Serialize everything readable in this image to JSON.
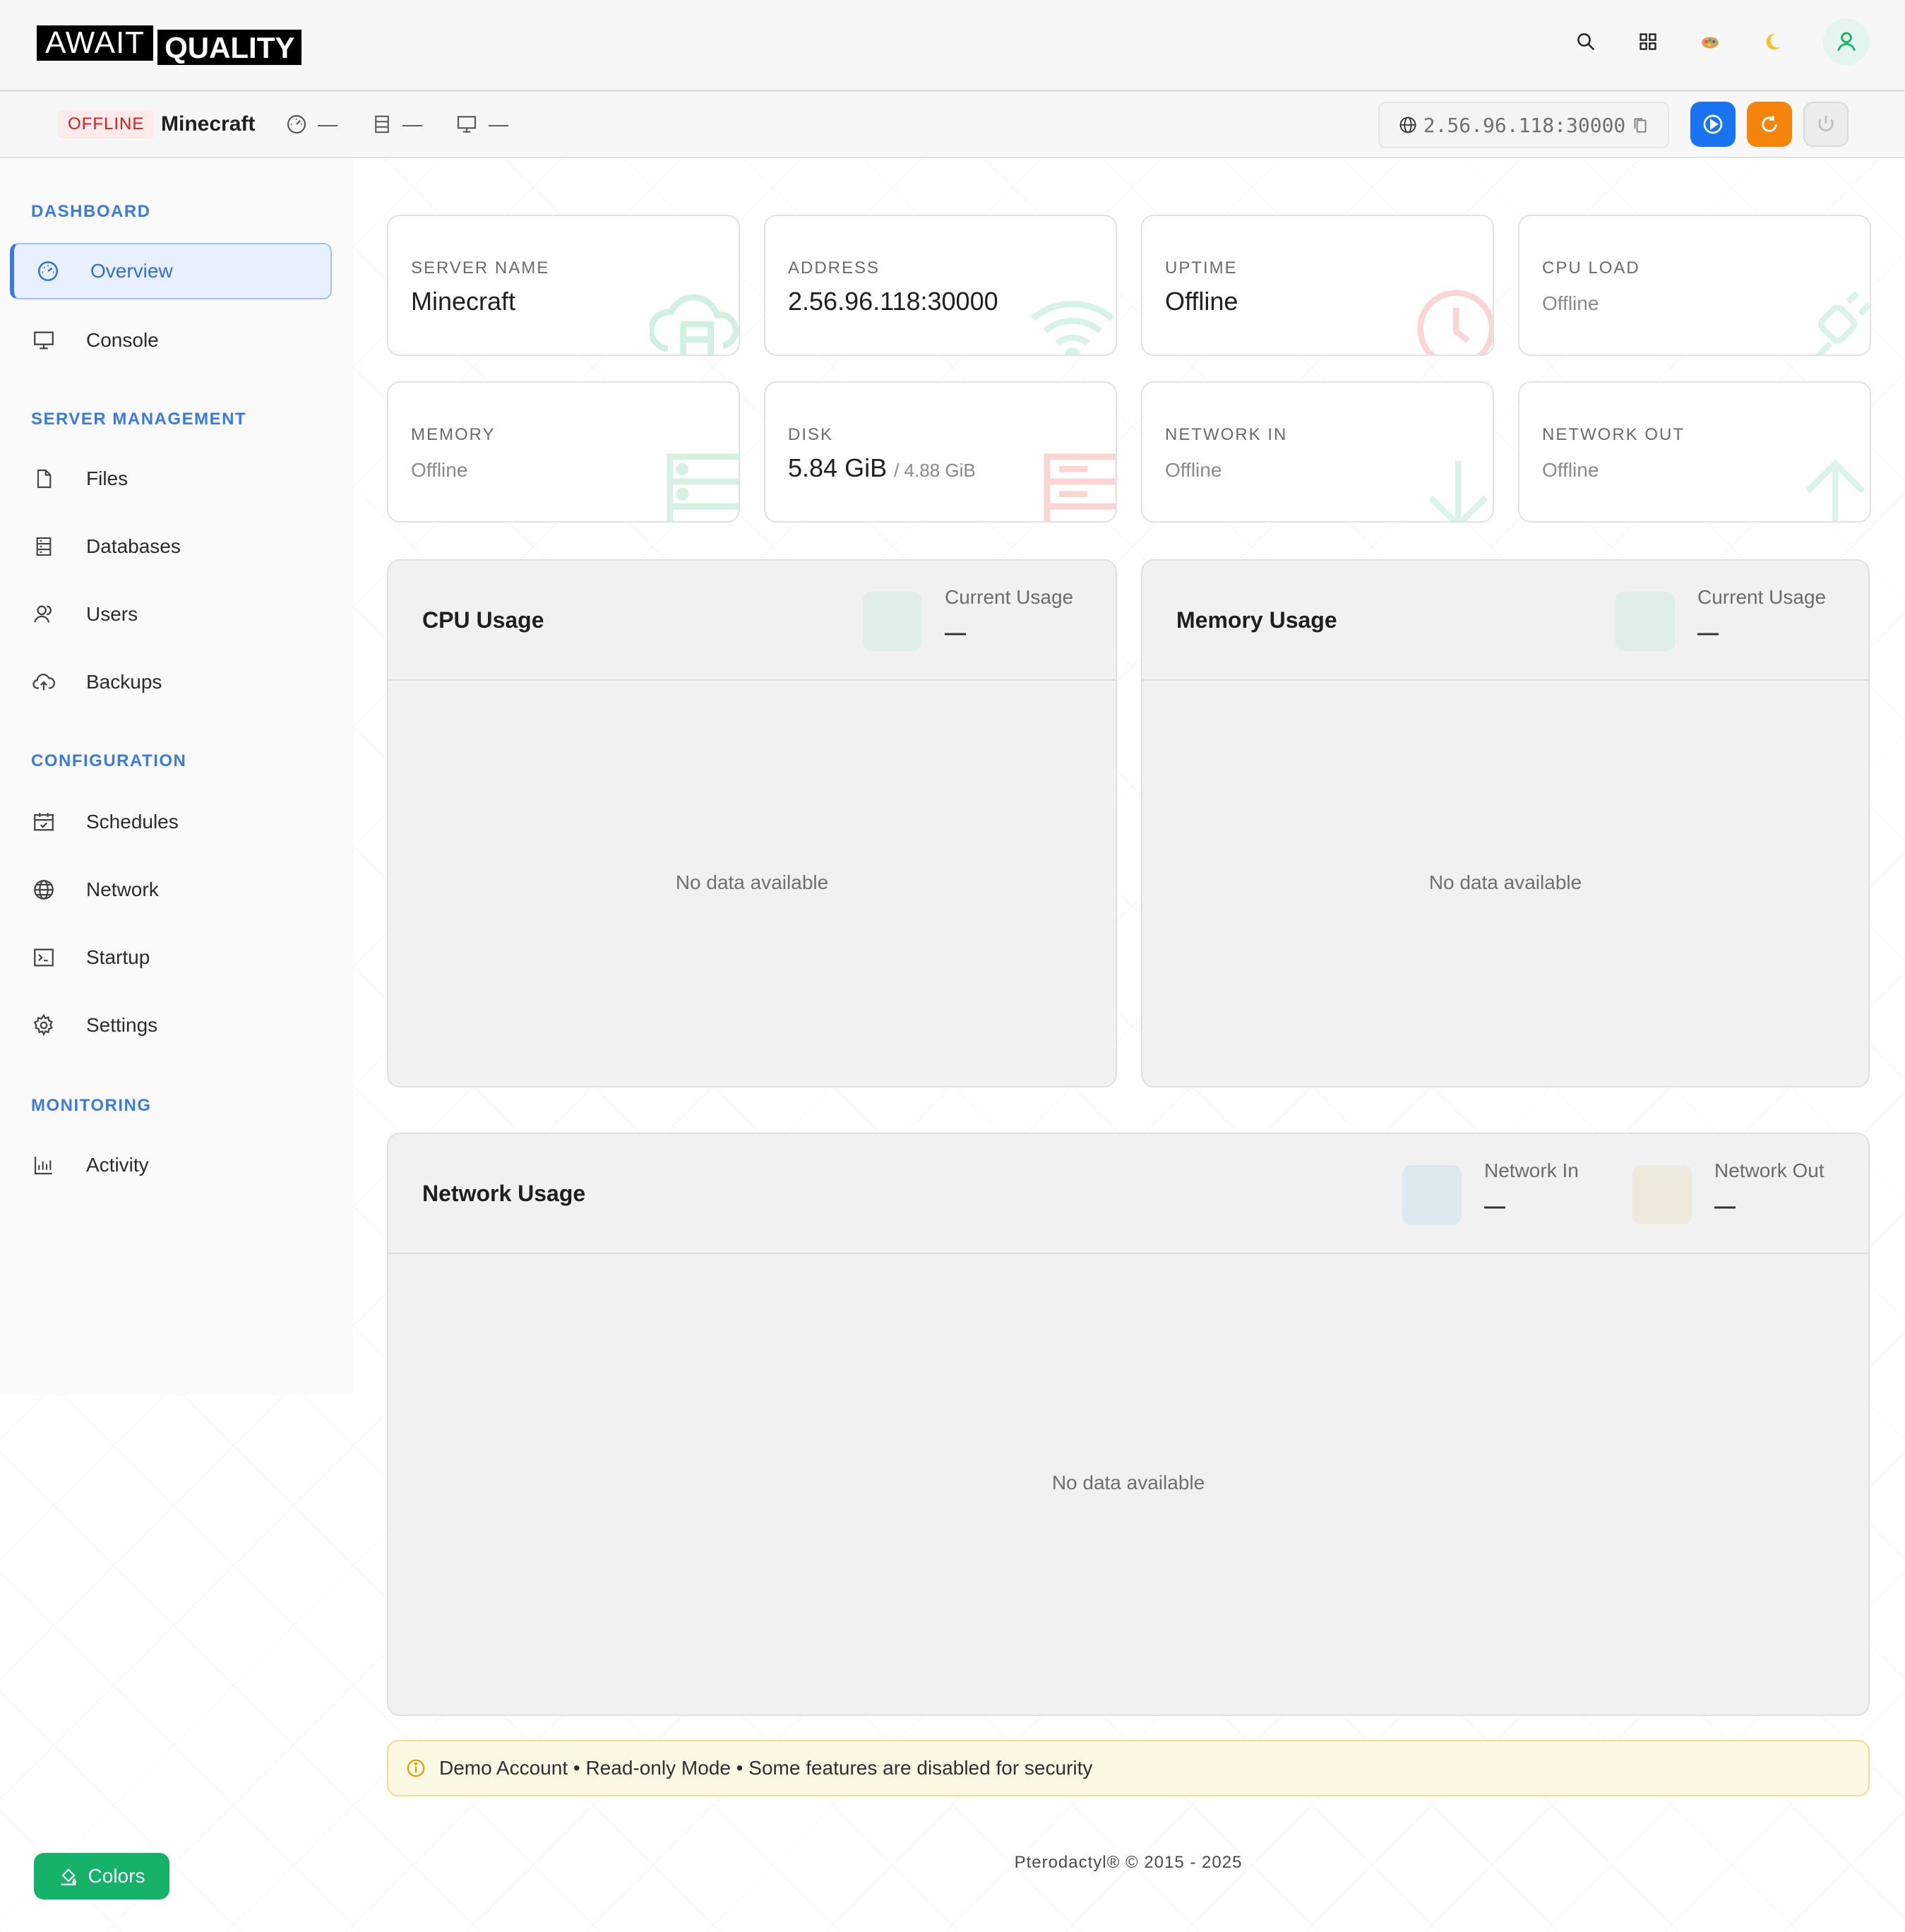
{
  "app": {
    "logo_part1": "AWAIT",
    "logo_part2": "QUALITY"
  },
  "header_icons": [
    "search-icon",
    "apps-grid-icon",
    "palette-icon",
    "moon-icon",
    "user-icon"
  ],
  "server": {
    "status": "OFFLINE",
    "name": "Minecraft",
    "cpu_mini": "—",
    "memory_mini": "—",
    "console_mini": "—",
    "address": "2.56.96.118:30000"
  },
  "colors": {
    "accent": "#3b7be0",
    "start": "#1a73f0",
    "restart": "#f5840a",
    "offline_red": "#d21d1d",
    "success": "#17b26a"
  },
  "sidebar": {
    "sections": [
      {
        "title": "DASHBOARD",
        "items": [
          {
            "label": "Overview",
            "icon": "gauge-icon",
            "active": true
          },
          {
            "label": "Console",
            "icon": "monitor-icon",
            "active": false
          }
        ]
      },
      {
        "title": "SERVER MANAGEMENT",
        "items": [
          {
            "label": "Files",
            "icon": "file-icon",
            "active": false
          },
          {
            "label": "Databases",
            "icon": "database-icon",
            "active": false
          },
          {
            "label": "Users",
            "icon": "users-icon",
            "active": false
          },
          {
            "label": "Backups",
            "icon": "cloud-upload-icon",
            "active": false
          }
        ]
      },
      {
        "title": "CONFIGURATION",
        "items": [
          {
            "label": "Schedules",
            "icon": "calendar-icon",
            "active": false
          },
          {
            "label": "Network",
            "icon": "globe-icon",
            "active": false
          },
          {
            "label": "Startup",
            "icon": "terminal-icon",
            "active": false
          },
          {
            "label": "Settings",
            "icon": "gear-icon",
            "active": false
          }
        ]
      },
      {
        "title": "MONITORING",
        "items": [
          {
            "label": "Activity",
            "icon": "bar-chart-icon",
            "active": false
          }
        ]
      }
    ]
  },
  "stats": {
    "server_name": {
      "label": "SERVER NAME",
      "value": "Minecraft"
    },
    "address": {
      "label": "ADDRESS",
      "value": "2.56.96.118:30000"
    },
    "uptime": {
      "label": "UPTIME",
      "value": "Offline"
    },
    "cpu_load": {
      "label": "CPU LOAD",
      "value": "Offline"
    },
    "memory": {
      "label": "MEMORY",
      "value": "Offline"
    },
    "disk": {
      "label": "DISK",
      "value": "5.84 GiB",
      "limit": "/ 4.88 GiB"
    },
    "network_in": {
      "label": "NETWORK IN",
      "value": "Offline"
    },
    "network_out": {
      "label": "NETWORK OUT",
      "value": "Offline"
    }
  },
  "panels": {
    "cpu": {
      "title": "CPU Usage",
      "legend_label": "Current Usage",
      "legend_value": "—",
      "empty": "No data available"
    },
    "memory": {
      "title": "Memory Usage",
      "legend_label": "Current Usage",
      "legend_value": "—",
      "empty": "No data available"
    },
    "network": {
      "title": "Network Usage",
      "in_label": "Network In",
      "in_value": "—",
      "out_label": "Network Out",
      "out_value": "—",
      "empty": "No data available"
    }
  },
  "notice": "Demo Account • Read-only Mode • Some features are disabled for security",
  "footer": "Pterodactyl® © 2015 - 2025",
  "colors_button": "Colors"
}
